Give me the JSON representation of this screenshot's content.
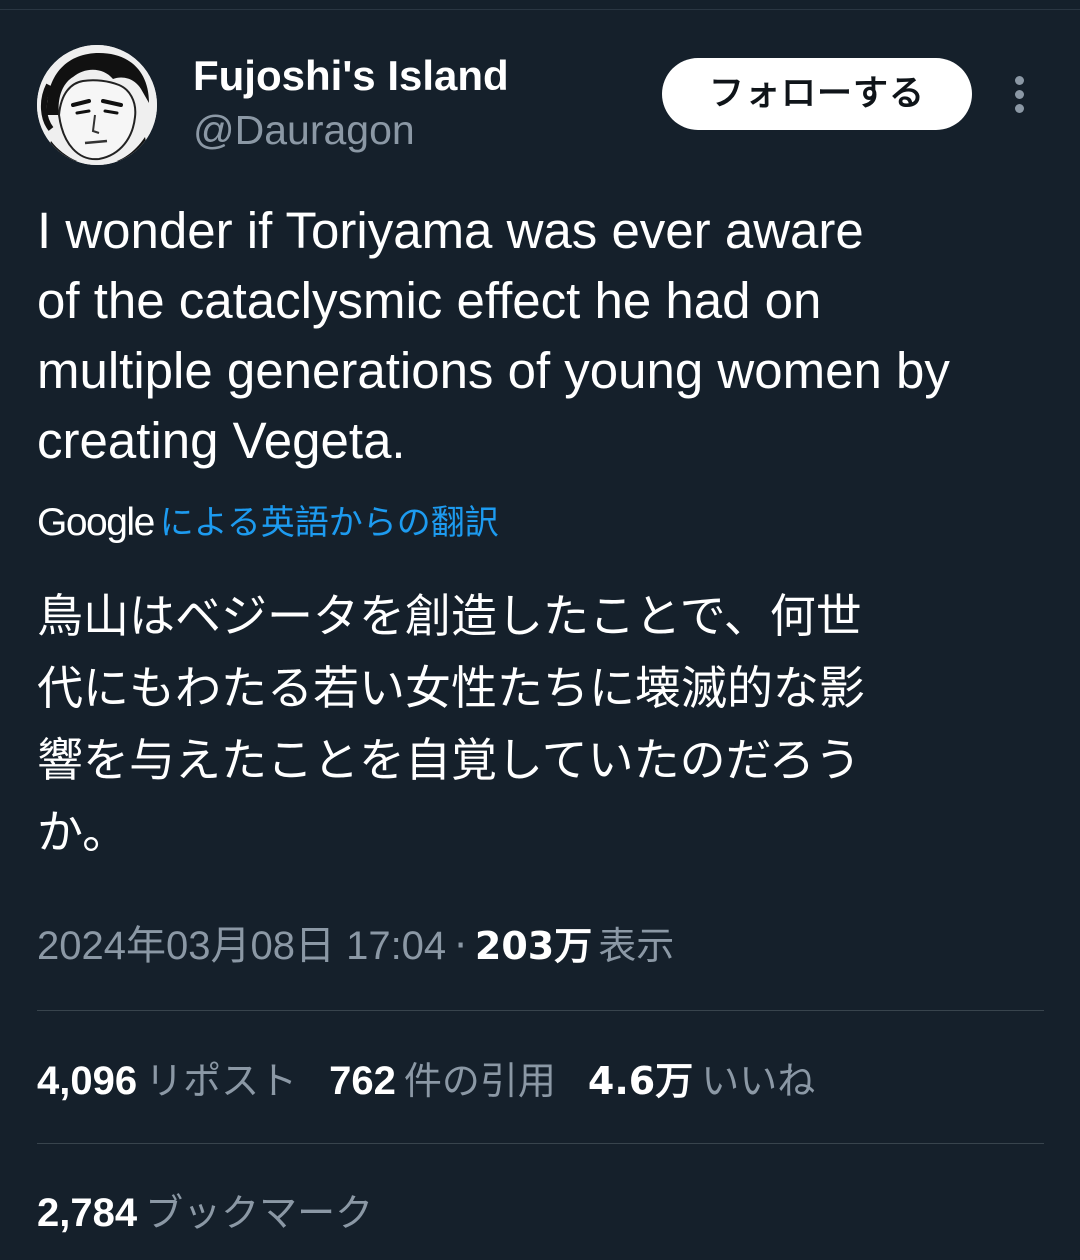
{
  "author": {
    "display_name": "Fujoshi's Island",
    "handle": "@Dauragon",
    "avatar_icon": "manga-character-avatar"
  },
  "actions": {
    "follow_label": "フォローする",
    "more_icon": "vertical-ellipsis-icon"
  },
  "tweet": {
    "text_lines": [
      "I wonder if Toriyama was ever aware",
      "of the cataclysmic effect he had on",
      "multiple generations of young women by",
      "creating Vegeta."
    ]
  },
  "translation": {
    "provider": "Google",
    "link_label": "による英語からの翻訳",
    "text_lines": [
      "鳥山はベジータを創造したことで、何世",
      "代にもわたる若い女性たちに壊滅的な影",
      "響を与えたことを自覚していたのだろう",
      "か。"
    ]
  },
  "meta": {
    "timestamp": "2024年03月08日 17:04",
    "separator": "·",
    "views_count": "203万",
    "views_label": "表示"
  },
  "stats": {
    "reposts_count": "4,096",
    "reposts_label": "リポスト",
    "quotes_count": "762",
    "quotes_label": "件の引用",
    "likes_count": "4.6万",
    "likes_label": "いいね",
    "bookmarks_count": "2,784",
    "bookmarks_label": "ブックマーク"
  },
  "colors": {
    "background": "#15202b",
    "text_primary": "#ffffff",
    "text_secondary": "#8b98a5",
    "link": "#1d9bf0",
    "divider": "#38444d"
  }
}
